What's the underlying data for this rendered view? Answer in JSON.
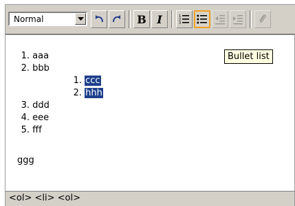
{
  "toolbar": {
    "format_select": {
      "value": "Normal"
    },
    "buttons": [
      {
        "name": "undo"
      },
      {
        "name": "redo"
      },
      {
        "name": "bold",
        "label": "B"
      },
      {
        "name": "italic",
        "label": "I"
      },
      {
        "name": "ordered-list"
      },
      {
        "name": "bullet-list",
        "state": "highlighted"
      },
      {
        "name": "outdent",
        "state": "disabled"
      },
      {
        "name": "indent",
        "state": "disabled"
      },
      {
        "name": "attach",
        "state": "disabled"
      }
    ]
  },
  "tooltip": "Bullet list",
  "content": {
    "list": [
      {
        "num": "1.",
        "text": "aaa"
      },
      {
        "num": "2.",
        "text": "bbb"
      },
      {
        "num": "1.",
        "text": "ccc",
        "selected": true
      },
      {
        "num": "2.",
        "text": "hhh",
        "selected": true
      },
      {
        "num": "3.",
        "text": "ddd"
      },
      {
        "num": "4.",
        "text": "eee"
      },
      {
        "num": "5.",
        "text": "fff"
      }
    ],
    "paragraph": "ggg"
  },
  "statusbar": {
    "path": "<ol> <li> <ol>"
  },
  "colors": {
    "toolbar_bg": "#d4d0c8",
    "selection": "#1e3f8c",
    "tooltip_bg": "#ffffe1",
    "active_button_border": "#f0a020"
  }
}
